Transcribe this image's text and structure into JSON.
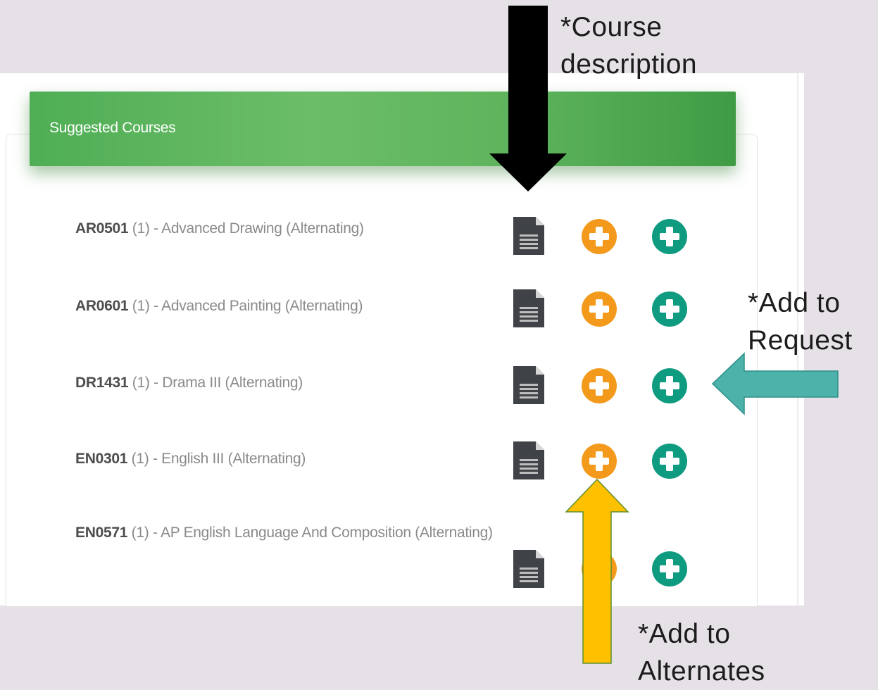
{
  "card": {
    "title": "Suggested Courses"
  },
  "courses": [
    {
      "code": "AR0501",
      "credits": "(1)",
      "name": "- Advanced Drawing (Alternating)"
    },
    {
      "code": "AR0601",
      "credits": "(1)",
      "name": "- Advanced Painting (Alternating)"
    },
    {
      "code": "DR1431",
      "credits": "(1)",
      "name": "- Drama III (Alternating)"
    },
    {
      "code": "EN0301",
      "credits": "(1)",
      "name": "- English III (Alternating)"
    },
    {
      "code": "EN0571",
      "credits": "(1)",
      "name": "- AP English Language And Composition (Alternating)"
    }
  ],
  "icons": {
    "description": "document-icon",
    "alternate": "orange-plus-circle-icon",
    "request": "teal-plus-circle-icon"
  },
  "annotations": {
    "course_description": {
      "line1": "*Course",
      "line2": "description"
    },
    "add_to_request": {
      "line1": "*Add to",
      "line2": "Request"
    },
    "add_to_alternates": {
      "line1": "*Add to",
      "line2": "Alternates"
    }
  },
  "colors": {
    "header_green": "#5bb35c",
    "alternate_orange": "#f39a1d",
    "request_teal": "#0f9b80",
    "document_dark": "#3f4246",
    "arrow_teal": "#4db3aa",
    "arrow_yellow": "#ffc000",
    "arrow_black": "#000000"
  }
}
